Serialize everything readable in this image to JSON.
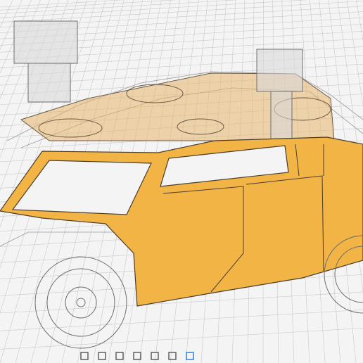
{
  "viewport": {
    "background": "#f4f4f4",
    "grid_color": "#c9c9c9",
    "body_color": "#f2b445",
    "body_stroke": "#5a4a35",
    "ghost_color": "#8a8a8a"
  },
  "toolbar": {
    "tools": [
      {
        "name": "orbit-icon",
        "color": "#555555"
      },
      {
        "name": "pan-icon",
        "color": "#555555"
      },
      {
        "name": "zoom-icon",
        "color": "#555555"
      },
      {
        "name": "fit-icon",
        "color": "#555555"
      },
      {
        "name": "display-mode-icon",
        "color": "#555555"
      },
      {
        "name": "grid-icon",
        "color": "#555555"
      },
      {
        "name": "viewports-icon",
        "color": "#1c7ad8"
      }
    ]
  }
}
